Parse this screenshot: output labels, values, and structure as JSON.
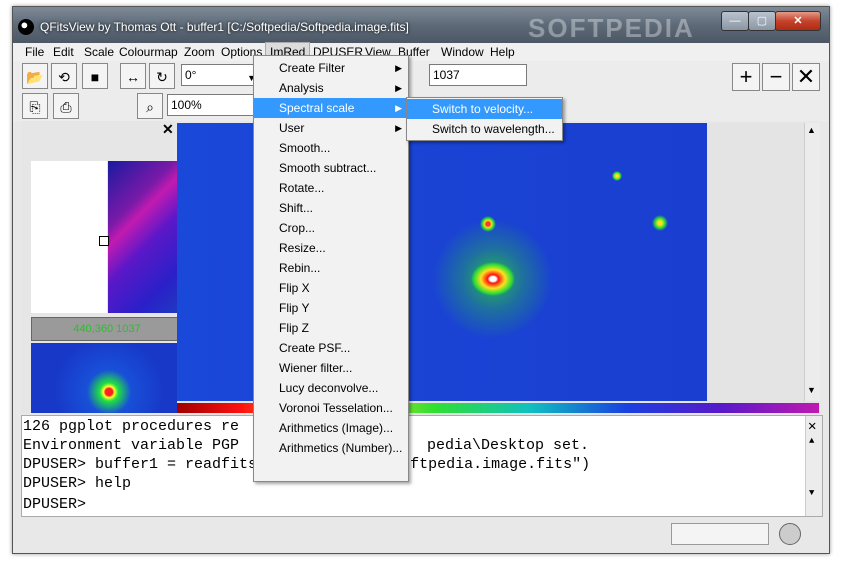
{
  "window": {
    "title": "QFitsView by Thomas Ott - buffer1 [C:/Softpedia/Softpedia.image.fits]",
    "watermark": "SOFTPEDIA"
  },
  "menubar": [
    "File",
    "Edit",
    "Scale",
    "Colourmap",
    "Zoom",
    "Options",
    "ImRed",
    "DPUSER",
    "View",
    "Buffer",
    "Window",
    "Help"
  ],
  "toolbar": {
    "rotation_value": "0°",
    "zoom_value": "100%",
    "value_field": "1037"
  },
  "left_panel": {
    "graybar_text": "440,360 1037"
  },
  "imred_menu": {
    "items": [
      {
        "label": "Create Filter",
        "submenu": true
      },
      {
        "label": "Analysis",
        "submenu": true
      },
      {
        "label": "Spectral scale",
        "submenu": true
      },
      {
        "label": "User",
        "submenu": true
      },
      {
        "label": "Smooth...",
        "submenu": false
      },
      {
        "label": "Smooth subtract...",
        "submenu": false
      },
      {
        "label": "Rotate...",
        "submenu": false
      },
      {
        "label": "Shift...",
        "submenu": false
      },
      {
        "label": "Crop...",
        "submenu": false
      },
      {
        "label": "Resize...",
        "submenu": false
      },
      {
        "label": "Rebin...",
        "submenu": false
      },
      {
        "label": "Flip X",
        "submenu": false
      },
      {
        "label": "Flip Y",
        "submenu": false
      },
      {
        "label": "Flip Z",
        "submenu": false
      },
      {
        "label": "Create PSF...",
        "submenu": false
      },
      {
        "label": "Wiener filter...",
        "submenu": false
      },
      {
        "label": "Lucy deconvolve...",
        "submenu": false
      },
      {
        "label": "Voronoi Tesselation...",
        "submenu": false
      },
      {
        "label": "Arithmetics (Image)...",
        "submenu": false
      },
      {
        "label": "Arithmetics (Number)...",
        "submenu": false
      }
    ],
    "highlighted": "Spectral scale"
  },
  "spectral_submenu": {
    "items": [
      "Switch to velocity...",
      "Switch to wavelength..."
    ],
    "highlighted": "Switch to velocity..."
  },
  "console": {
    "lines": [
      "126 pgplot procedures re",
      "Environment variable PGP",
      "DPUSER> buffer1 = readfits(\"C:/Softpedia/Softpedia.image.fits\")",
      "DPUSER> help",
      "DPUSER>"
    ],
    "line1_tail": "pedia\\Desktop set."
  },
  "colors": {
    "menu_highlight": "#3399ff",
    "image_background": "#1a48d8"
  }
}
